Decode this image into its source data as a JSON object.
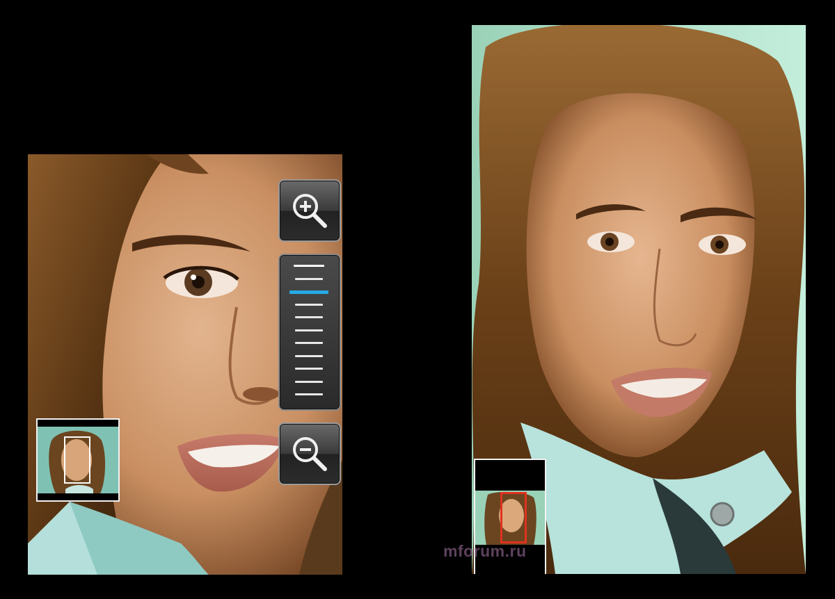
{
  "screens": {
    "left": {
      "zoom_in_icon": "zoom-in-magnifier-icon",
      "zoom_out_icon": "zoom-out-magnifier-icon",
      "zoom_level": {
        "index": 2,
        "count": 11
      }
    },
    "right": {}
  },
  "watermark": {
    "text": "mforum.ru"
  },
  "colors": {
    "background": "#000000",
    "slider_active": "#27a9e6",
    "nav_viewport_left": "#ffffff",
    "nav_viewport_right": "#e0321f"
  }
}
